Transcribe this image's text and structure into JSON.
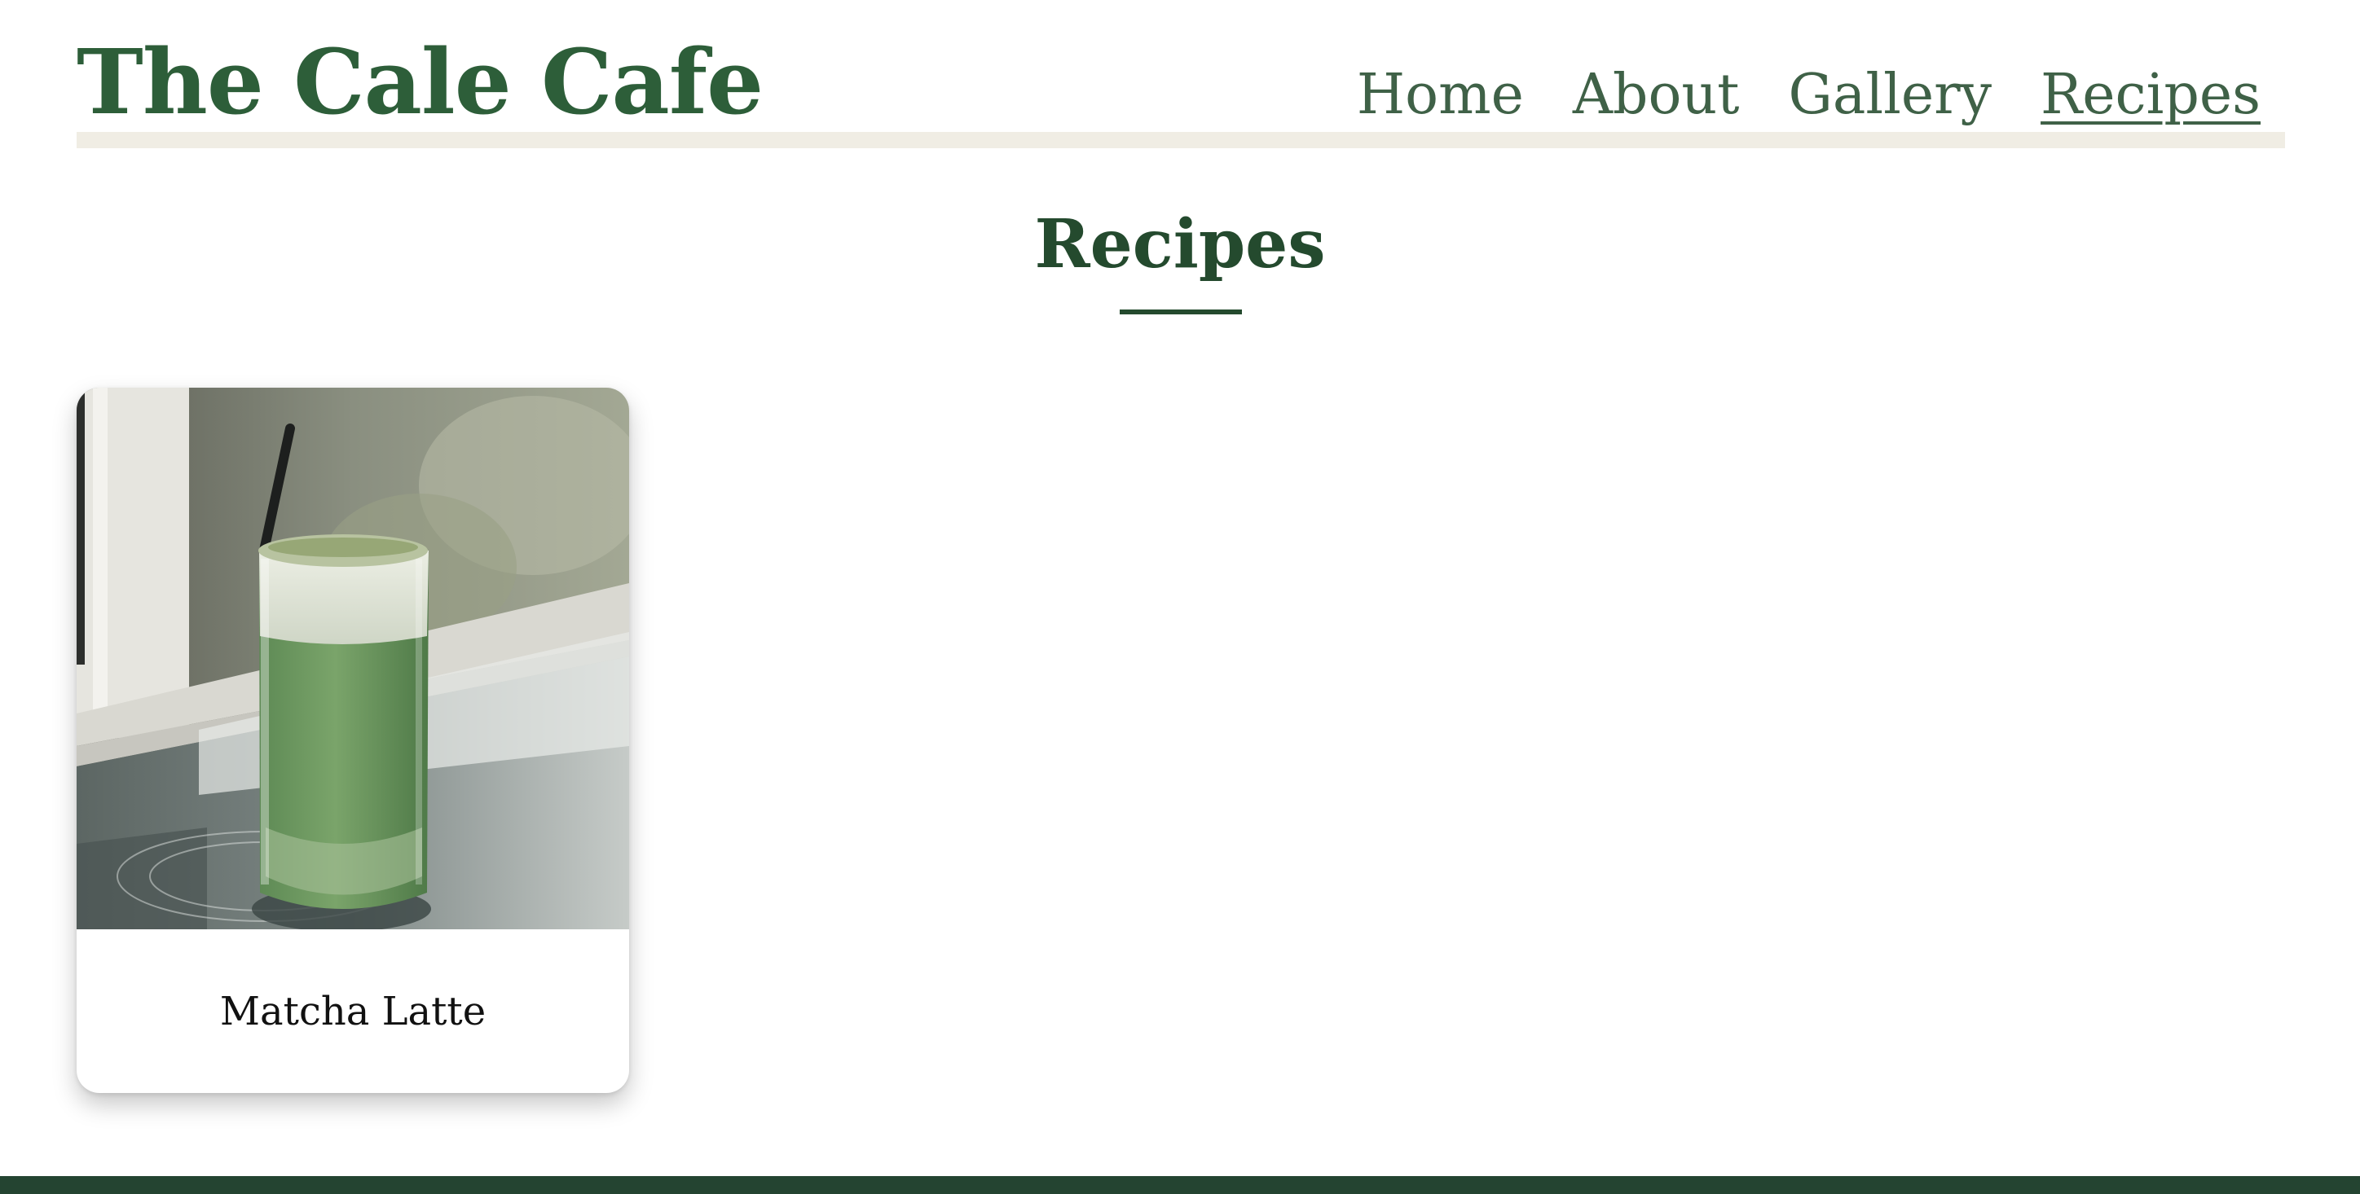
{
  "header": {
    "site_title": "The Cale Cafe",
    "nav": [
      {
        "label": "Home",
        "active": false
      },
      {
        "label": "About",
        "active": false
      },
      {
        "label": "Gallery",
        "active": false
      },
      {
        "label": "Recipes",
        "active": true
      }
    ]
  },
  "main": {
    "page_title": "Recipes",
    "recipes": [
      {
        "title": "Matcha Latte",
        "image": "iced-matcha-latte-photo"
      }
    ]
  },
  "colors": {
    "brand_green": "#2d5e39",
    "nav_green": "#3f6147",
    "dark_green": "#244a2e",
    "rule_beige": "#f0ede4",
    "footer_green": "#244431"
  }
}
